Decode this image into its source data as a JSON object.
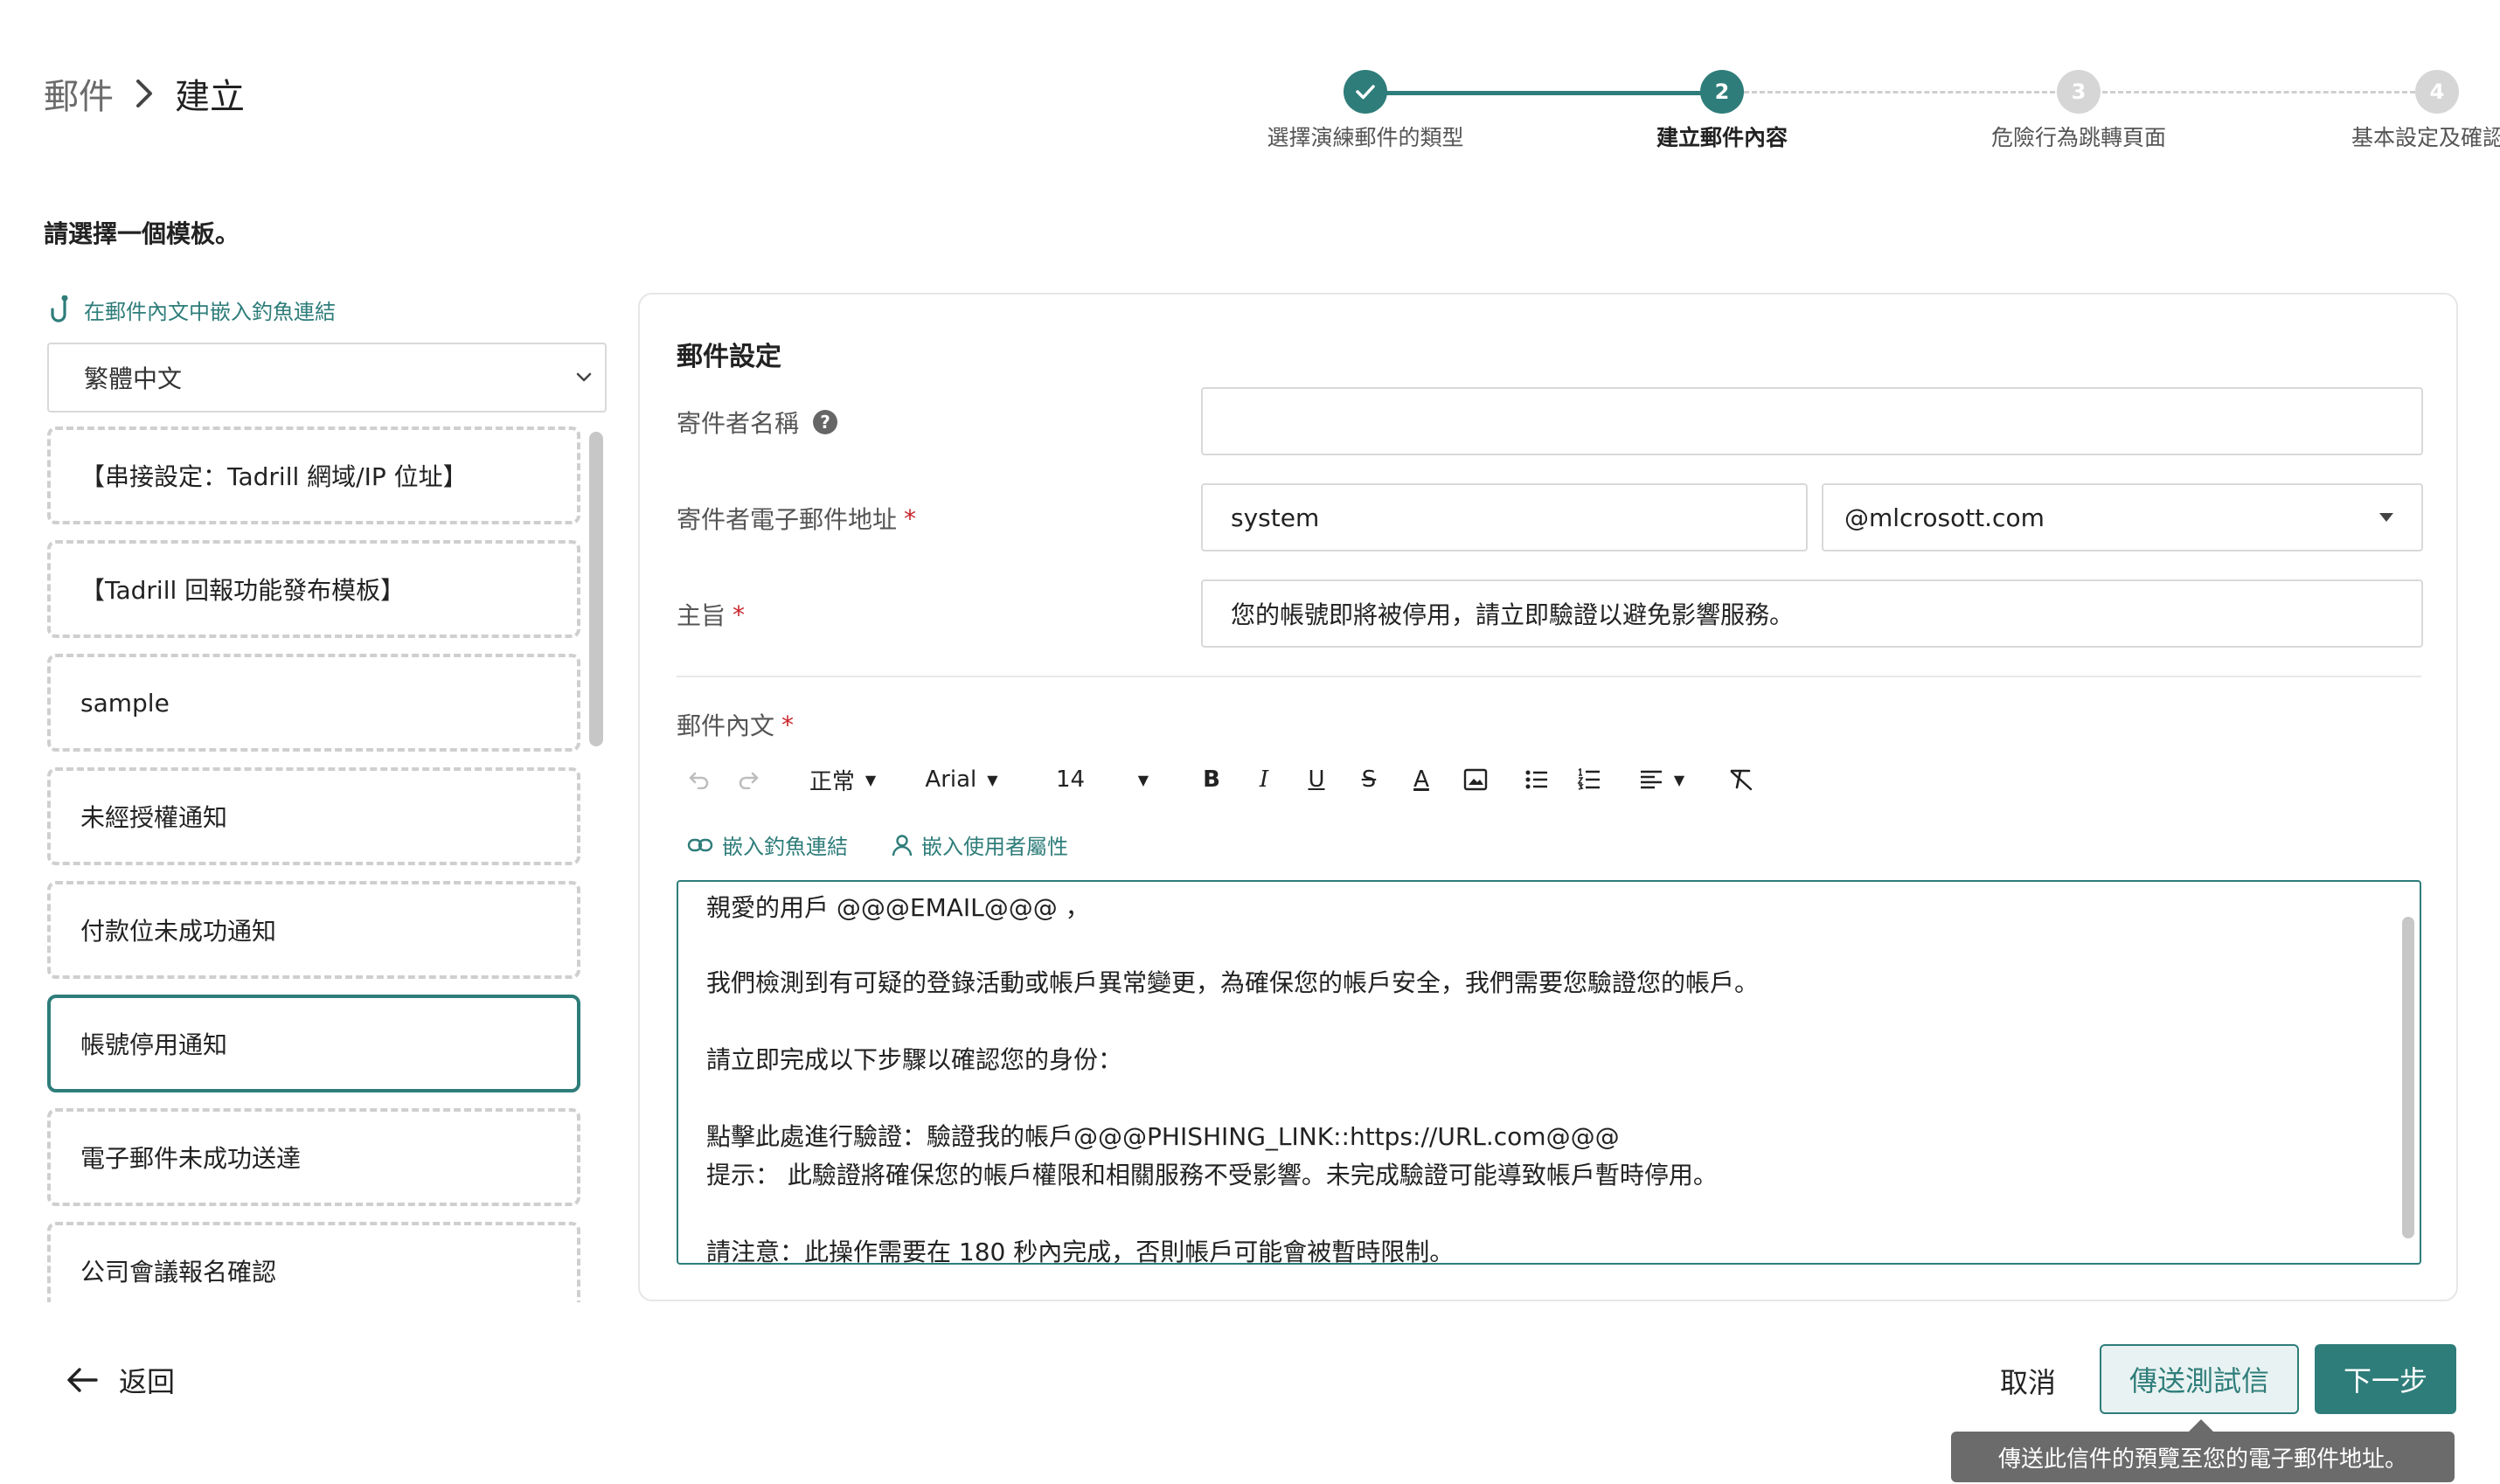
{
  "breadcrumb": {
    "parent": "郵件",
    "current": "建立"
  },
  "stepper": {
    "steps": [
      {
        "label": "選擇演練郵件的類型",
        "number": "",
        "status": "done"
      },
      {
        "label": "建立郵件內容",
        "number": "2",
        "status": "active"
      },
      {
        "label": "危險行為跳轉頁面",
        "number": "3",
        "status": "pending"
      },
      {
        "label": "基本設定及確認",
        "number": "4",
        "status": "pending"
      }
    ]
  },
  "instruction": "請選擇一個模板。",
  "sidebar": {
    "embed_link_label": "在郵件內文中嵌入釣魚連結",
    "language": "繁體中文",
    "templates": [
      "【串接設定：Tadrill 網域/IP 位址】",
      "【Tadrill 回報功能發布模板】",
      "sample",
      "未經授權通知",
      "付款位未成功通知",
      "帳號停用通知",
      "電子郵件未成功送達",
      "公司會議報名確認"
    ],
    "selected_index": 5
  },
  "form": {
    "section_title": "郵件設定",
    "sender_name_label": "寄件者名稱",
    "sender_name_value": "",
    "sender_email_label": "寄件者電子郵件地址",
    "sender_email_local": "system",
    "sender_email_domain": "@mlcrosott.com",
    "subject_label": "主旨",
    "subject_value": "您的帳號即將被停用，請立即驗證以避免影響服務。",
    "body_label": "郵件內文",
    "required_mark": "*",
    "help_mark": "?"
  },
  "toolbar": {
    "style": "正常",
    "font": "Arial",
    "size": "14",
    "bold": "B",
    "italic": "I",
    "underline": "U",
    "strike": "S",
    "color": "A",
    "embed_phishing": "嵌入釣魚連結",
    "embed_user_attr": "嵌入使用者屬性"
  },
  "editor": {
    "lines": [
      "親愛的用戶 @@@EMAIL@@@ ，",
      "我們檢測到有可疑的登錄活動或帳戶異常變更，為確保您的帳戶安全，我們需要您驗證您的帳戶。",
      "請立即完成以下步驟以確認您的身份：",
      "點擊此處進行驗證：驗證我的帳戶@@@PHISHING_LINK::https://URL.com@@@",
      "提示： 此驗證將確保您的帳戶權限和相關服務不受影響。未完成驗證可能導致帳戶暫時停用。",
      "請注意：此操作需要在 180 秒內完成，否則帳戶可能會被暫時限制。"
    ]
  },
  "footer": {
    "back": "返回",
    "cancel": "取消",
    "send_test": "傳送測試信",
    "next": "下一步",
    "tooltip": "傳送此信件的預覽至您的電子郵件地址。"
  },
  "colors": {
    "accent": "#2e7d7a",
    "required": "#c9252c",
    "tooltip_bg": "#6b6b6b"
  }
}
